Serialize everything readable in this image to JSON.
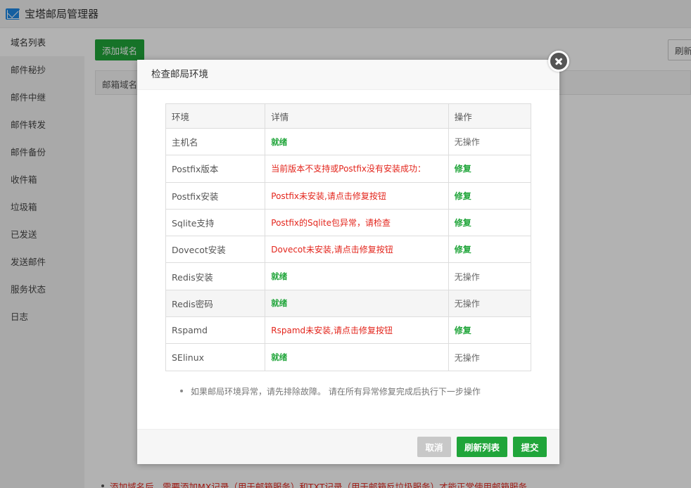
{
  "app": {
    "title": "宝塔邮局管理器"
  },
  "sidebar": {
    "items": [
      {
        "label": "域名列表"
      },
      {
        "label": "邮件秘抄"
      },
      {
        "label": "邮件中继"
      },
      {
        "label": "邮件转发"
      },
      {
        "label": "邮件备份"
      },
      {
        "label": "收件箱"
      },
      {
        "label": "垃圾箱"
      },
      {
        "label": "已发送"
      },
      {
        "label": "发送邮件"
      },
      {
        "label": "服务状态"
      },
      {
        "label": "日志"
      }
    ]
  },
  "main": {
    "add_domain_label": "添加域名",
    "refresh_label": "刷新",
    "table_header": "邮箱域名",
    "bottom_note": "添加域名后，需要添加MX记录（用于邮箱服务）和TXT记录（用于邮箱反垃圾服务）才能正常使用邮箱服务"
  },
  "modal": {
    "title": "检查邮局环境",
    "columns": {
      "env": "环境",
      "detail": "详情",
      "op": "操作"
    },
    "rows": [
      {
        "env": "主机名",
        "detail": "就绪",
        "op": "无操作"
      },
      {
        "env": "Postfix版本",
        "detail": "当前版本不支持或Postfix没有安装成功：",
        "op": "修复"
      },
      {
        "env": "Postfix安装",
        "detail": "Postfix未安装,请点击修复按钮",
        "op": "修复"
      },
      {
        "env": "Sqlite支持",
        "detail": "Postfix的Sqlite包异常，请检查",
        "op": "修复"
      },
      {
        "env": "Dovecot安装",
        "detail": "Dovecot未安装,请点击修复按钮",
        "op": "修复"
      },
      {
        "env": "Redis安装",
        "detail": "就绪",
        "op": "无操作"
      },
      {
        "env": "Redis密码",
        "detail": "就绪",
        "op": "无操作"
      },
      {
        "env": "Rspamd",
        "detail": "Rspamd未安装,请点击修复按钮",
        "op": "修复"
      },
      {
        "env": "SElinux",
        "detail": "就绪",
        "op": "无操作"
      }
    ],
    "tip": "如果邮局环境异常，请先排除故障。 请在所有异常修复完成后执行下一步操作",
    "buttons": {
      "cancel": "取消",
      "refresh": "刷新列表",
      "submit": "提交"
    }
  },
  "colors": {
    "accent_green": "#20a53a",
    "error_red": "#e3251c"
  }
}
